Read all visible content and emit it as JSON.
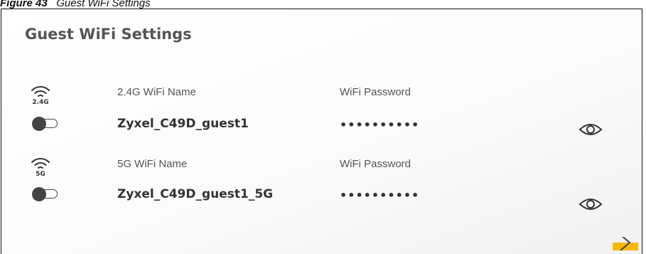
{
  "figure": {
    "prefix": "Figure 43",
    "title": "Guest WiFi Settings"
  },
  "page": {
    "title": "Guest WiFi Settings"
  },
  "networks": [
    {
      "band": "2.4G",
      "name_label": "2.4G WiFi Name",
      "name_value": "Zyxel_C49D_guest1",
      "password_label": "WiFi Password",
      "password_value": "••••••••••",
      "enabled": false
    },
    {
      "band": "5G",
      "name_label": "5G WiFi Name",
      "name_value": "Zyxel_C49D_guest1_5G",
      "password_label": "WiFi Password",
      "password_value": "••••••••••",
      "enabled": false
    }
  ],
  "colors": {
    "accent": "#f5b800",
    "toggle_off": "#444444"
  },
  "icons": {
    "band": "wifi-icon",
    "show_password": "eye-icon",
    "next": "chevron-right-icon"
  }
}
